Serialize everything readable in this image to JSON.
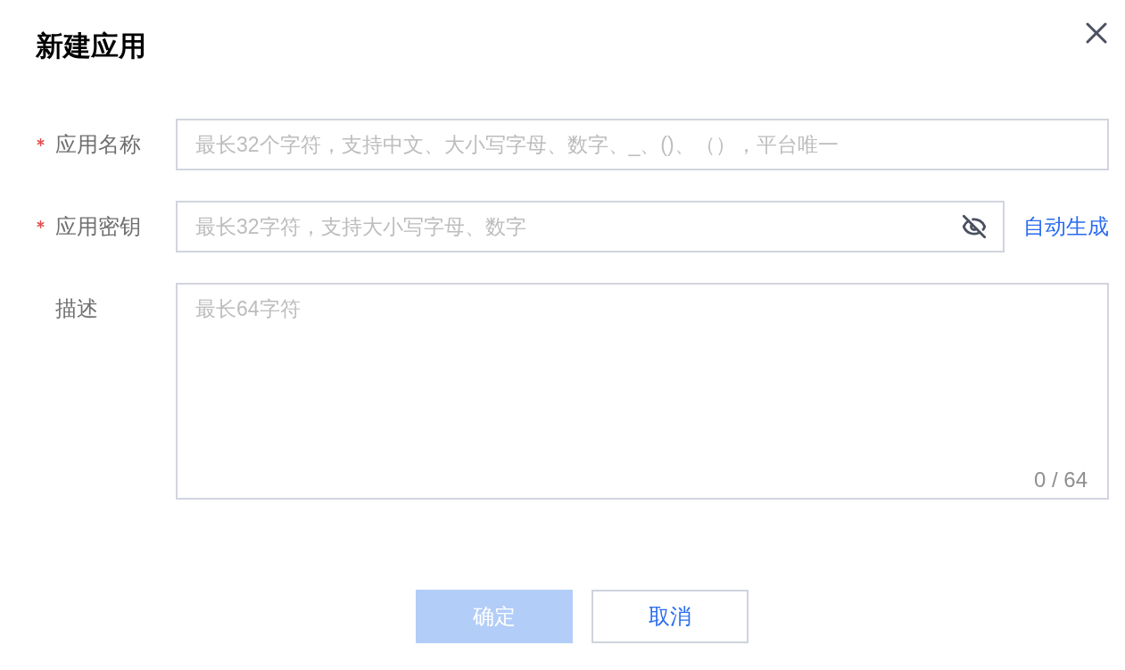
{
  "dialog": {
    "title": "新建应用"
  },
  "fields": [
    {
      "kind": "text",
      "label": "应用名称",
      "required": true,
      "placeholder": "最长32个字符，支持中文、大小写字母、数字、_、()、（），平台唯一"
    },
    {
      "kind": "secret",
      "label": "应用密钥",
      "required": true,
      "placeholder": "最长32字符，支持大小写字母、数字",
      "visible": false,
      "action": "自动生成"
    },
    {
      "kind": "textarea",
      "label": "描述",
      "required": false,
      "placeholder": "最长64字符",
      "counter": "0 / 64"
    }
  ],
  "buttons": [
    {
      "label": "确定",
      "kind": "primary",
      "disabled": true
    },
    {
      "label": "取消",
      "kind": "secondary",
      "disabled": false
    }
  ]
}
